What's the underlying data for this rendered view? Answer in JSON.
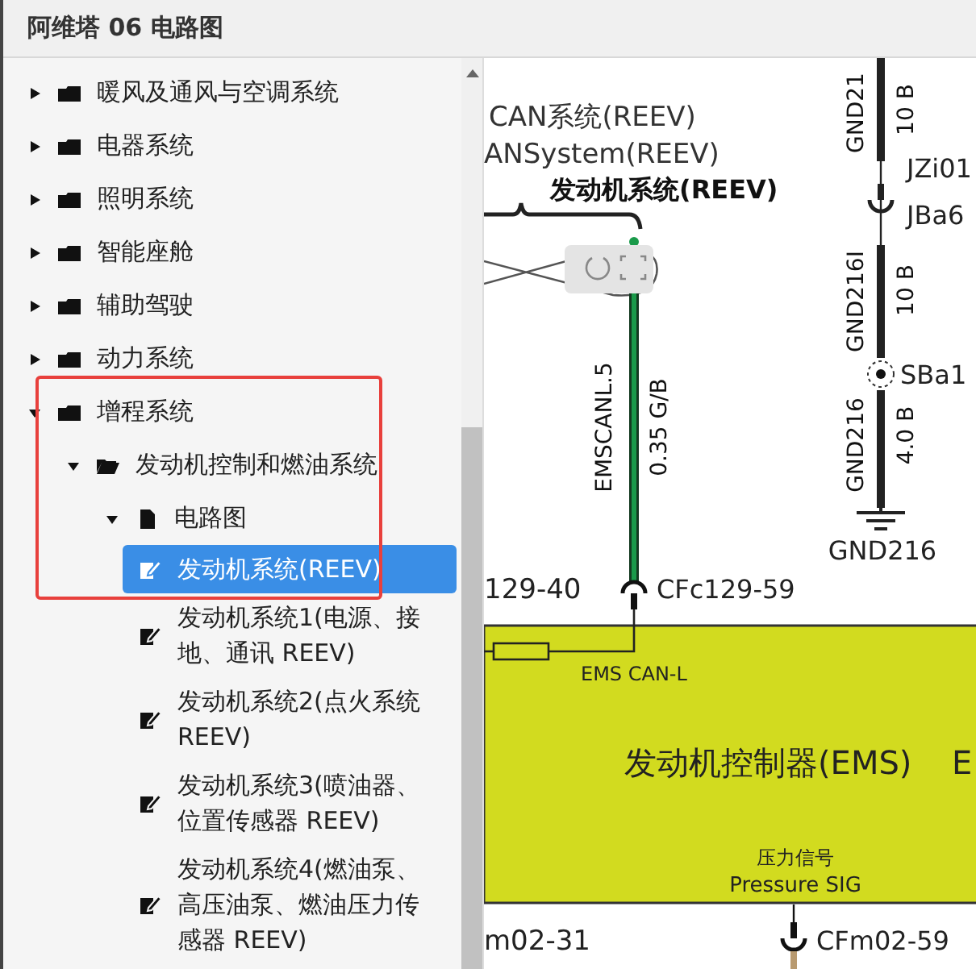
{
  "window": {
    "title": "阿维塔 06 电路图"
  },
  "tree": {
    "items": [
      {
        "label": "暖风及通风与空调系统",
        "kind": "folder",
        "expanded": false,
        "selected": false
      },
      {
        "label": "电器系统",
        "kind": "folder",
        "expanded": false,
        "selected": false
      },
      {
        "label": "照明系统",
        "kind": "folder",
        "expanded": false,
        "selected": false
      },
      {
        "label": "智能座舱",
        "kind": "folder",
        "expanded": false,
        "selected": false
      },
      {
        "label": "辅助驾驶",
        "kind": "folder",
        "expanded": false,
        "selected": false
      },
      {
        "label": "动力系统",
        "kind": "folder",
        "expanded": false,
        "selected": false
      },
      {
        "label": "增程系统",
        "kind": "folder",
        "expanded": true,
        "selected": false,
        "children": [
          {
            "label": "发动机控制和燃油系统",
            "kind": "folder-open",
            "expanded": true,
            "selected": false,
            "children": [
              {
                "label": "电路图",
                "kind": "file",
                "expanded": true,
                "selected": false,
                "children": [
                  {
                    "label": "发动机系统(REEV)",
                    "kind": "diagram",
                    "selected": true
                  },
                  {
                    "label": "发动机系统1(电源、接地、通讯 REEV)",
                    "kind": "diagram",
                    "selected": false
                  },
                  {
                    "label": "发动机系统2(点火系统 REEV)",
                    "kind": "diagram",
                    "selected": false
                  },
                  {
                    "label": "发动机系统3(喷油器、位置传感器 REEV)",
                    "kind": "diagram",
                    "selected": false
                  },
                  {
                    "label": "发动机系统4(燃油泵、高压油泵、燃油压力传感器 REEV)",
                    "kind": "diagram",
                    "selected": false
                  }
                ]
              }
            ]
          }
        ]
      }
    ]
  },
  "diagram": {
    "captions": [
      "CAN系统(REEV)",
      "ANSystem(REEV)"
    ],
    "title": "发动机系统(REEV)",
    "green_wire": {
      "name": "EMSCANL.5",
      "spec": "0.35 G/B"
    },
    "ground_wires": [
      {
        "name": "GND21",
        "spec": "10 B"
      },
      {
        "name": "GND216I",
        "spec": "10 B"
      },
      {
        "name": "GND216",
        "spec": "4.0 B"
      }
    ],
    "connector_labels": [
      "JZi01",
      "JBa6"
    ],
    "splice": "SBa1",
    "ground": "GND216",
    "pins": [
      {
        "left": "129-40",
        "right": "CFc129-59"
      },
      {
        "left": "m02-31",
        "right": "CFm02-59"
      }
    ],
    "module": {
      "name": "发动机控制器(EMS)",
      "name_next": "E",
      "signal": "EMS CAN-L",
      "pressure": [
        "压力信号",
        "Pressure SIG"
      ]
    }
  }
}
